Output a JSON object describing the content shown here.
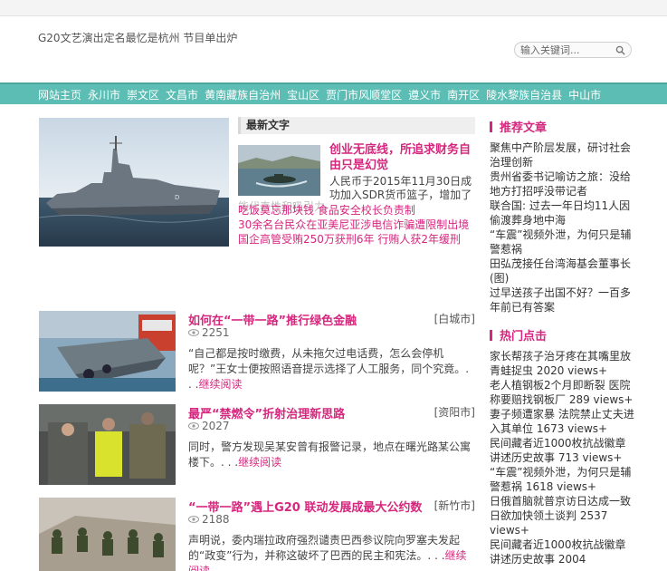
{
  "header": {
    "slogan": "G20文艺演出定名最忆是杭州 节目单出炉",
    "search_placeholder": "输入关键词..."
  },
  "nav": {
    "items": [
      "网站主页",
      "永川市",
      "崇文区",
      "文昌市",
      "黄南藏族自治州",
      "宝山区",
      "贾门市风顺堂区",
      "遵义市",
      "南开区",
      "陵水黎族自治县",
      "中山市"
    ]
  },
  "latest": {
    "heading": "最新文字",
    "feature_title": "创业无底线，所追求财务自由只是幻觉",
    "feature_summary": "人民币于2015年11月30日成功加入SDR货币篮子，增加了SDR",
    "ghost_text": "能代表性和吸引力",
    "links": [
      "吃饭莫忘那块钱 食品安全校长负责制",
      "30余名台民众在亚美尼亚涉电信诈骗遭限制出境",
      "国企高管受贿250万获刑6年 行贿人获2年缓刑"
    ]
  },
  "articles": [
    {
      "title": "如何在“一带一路”推行绿色金融",
      "category": "[白城市]",
      "views": "2251",
      "excerpt": "“自己都是按时缴费，从未拖欠过电话费，怎么会停机呢？”王女士便按照语音提示选择了人工服务，同个究竟。. . .",
      "more": "继续阅读"
    },
    {
      "title": "最严“禁燃令”折射治理新思路",
      "category": "[资阳市]",
      "views": "2027",
      "excerpt": "同时，警方发现吴某安曾有报警记录，地点在曙光路某公寓楼下。. . .",
      "more": "继续阅读"
    },
    {
      "title": "“一带一路”遇上G20  联动发展成最大公约数",
      "category": "[新竹市]",
      "views": "2188",
      "excerpt": "声明说，委内瑞拉政府强烈谴责巴西参议院向罗塞夫发起的“政变”行为，并称这破坏了巴西的民主和宪法。. . .",
      "more": "继续阅读"
    }
  ],
  "sidebar": {
    "recommend_heading": "推荐文章",
    "recommend": [
      "聚焦中产阶层发展，研讨社会治理创新",
      "贵州省委书记喻访之旅：没给地方打招呼没带记者",
      "联合国: 过去一年日均11人因偷渡葬身地中海",
      "“车震”视频外泄，为何只是辅警惹祸",
      "田弘茂接任台湾海基会董事长(图)",
      "过早送孩子出国不好？一百多年前已有答案"
    ],
    "hot_heading": "热门点击",
    "hot": [
      "家长帮孩子治牙疼在其嘴里放青蛙捉虫  2020 views+",
      "老人植钢板2个月即断裂 医院称要赔找钢板厂  289 views+",
      "妻子频遭家暴 法院禁止丈夫进入其单位  1673 views+",
      "民间藏者近1000枚抗战徽章讲述历史故事  713 views+",
      "“车震”视频外泄，为何只是辅警惹祸  1618 views+",
      "日俄首脑就普京访日达成一致日欲加快领土谈判  2537 views+",
      "民间藏者近1000枚抗战徽章讲述历史故事  2004"
    ]
  },
  "colors": {
    "accent": "#d6277e",
    "nav_bg": "#5bbdb3"
  }
}
